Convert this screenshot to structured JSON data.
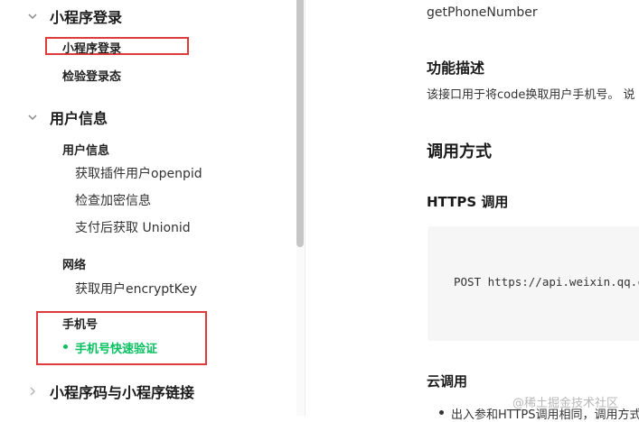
{
  "sidebar": {
    "sections": [
      {
        "title": "小程序登录",
        "expanded": true,
        "items": [
          {
            "label": "小程序登录",
            "active": true
          },
          {
            "label": "检验登录态"
          }
        ]
      },
      {
        "title": "用户信息",
        "expanded": true,
        "groups": [
          {
            "title": "用户信息",
            "items": [
              "获取插件用户openpid",
              "检查加密信息",
              "支付后获取 Unionid"
            ]
          },
          {
            "title": "网络",
            "items": [
              "获取用户encryptKey"
            ]
          },
          {
            "title": "手机号",
            "items": [
              "手机号快速验证"
            ],
            "active_item": "手机号快速验证"
          }
        ]
      },
      {
        "title": "小程序码与小程序链接",
        "expanded": false
      }
    ],
    "colors": {
      "active": "#07c160",
      "highlight_border": "#e03b3b"
    }
  },
  "content": {
    "api_name": "getPhoneNumber",
    "func_desc_heading": "功能描述",
    "func_desc_text": "该接口用于将code换取用户手机号。 说",
    "call_heading": "调用方式",
    "https_heading": "HTTPS 调用",
    "code_line": "POST https://api.weixin.qq.com",
    "cloud_heading": "云调用",
    "cloud_bullet": "出入参和HTTPS调用相同，调用方式"
  },
  "watermark": "@稀土掘金技术社区"
}
